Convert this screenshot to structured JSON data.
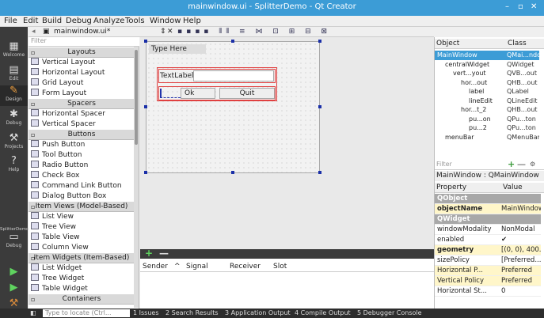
{
  "window": {
    "title": "mainwindow.ui - SplitterDemo - Qt Creator",
    "min": "–",
    "max": "▫",
    "close": "✕"
  },
  "menu": [
    "File",
    "Edit",
    "Build",
    "Debug",
    "Analyze",
    "Tools",
    "Window",
    "Help"
  ],
  "modes": [
    {
      "label": "Welcome",
      "icon": "▦"
    },
    {
      "label": "Edit",
      "icon": "▤"
    },
    {
      "label": "Design",
      "icon": "✎"
    },
    {
      "label": "Debug",
      "icon": "✱"
    },
    {
      "label": "Projects",
      "icon": "⚒"
    },
    {
      "label": "Help",
      "icon": "?"
    }
  ],
  "project": {
    "name": "SplitterDemo",
    "kit": "Debug"
  },
  "file_tab": {
    "name": "mainwindow.ui*",
    "close": "✕"
  },
  "widgetbox": {
    "filter_placeholder": "Filter",
    "rows": [
      {
        "type": "cat",
        "label": "Layouts"
      },
      {
        "type": "item",
        "label": "Vertical Layout"
      },
      {
        "type": "item",
        "label": "Horizontal Layout"
      },
      {
        "type": "item",
        "label": "Grid Layout"
      },
      {
        "type": "item",
        "label": "Form Layout"
      },
      {
        "type": "cat",
        "label": "Spacers"
      },
      {
        "type": "item",
        "label": "Horizontal Spacer"
      },
      {
        "type": "item",
        "label": "Vertical Spacer"
      },
      {
        "type": "cat",
        "label": "Buttons"
      },
      {
        "type": "item",
        "label": "Push Button"
      },
      {
        "type": "item",
        "label": "Tool Button"
      },
      {
        "type": "item",
        "label": "Radio Button"
      },
      {
        "type": "item",
        "label": "Check Box"
      },
      {
        "type": "item",
        "label": "Command Link Button"
      },
      {
        "type": "item",
        "label": "Dialog Button Box"
      },
      {
        "type": "cat",
        "label": "Item Views (Model-Based)"
      },
      {
        "type": "item",
        "label": "List View"
      },
      {
        "type": "item",
        "label": "Tree View"
      },
      {
        "type": "item",
        "label": "Table View"
      },
      {
        "type": "item",
        "label": "Column View"
      },
      {
        "type": "cat",
        "label": "Item Widgets (Item-Based)"
      },
      {
        "type": "item",
        "label": "List Widget"
      },
      {
        "type": "item",
        "label": "Tree Widget"
      },
      {
        "type": "item",
        "label": "Table Widget"
      },
      {
        "type": "cat",
        "label": "Containers"
      }
    ]
  },
  "form": {
    "menu_placeholder": "Type Here",
    "label": "TextLabel",
    "ok": "Ok",
    "quit": "Quit"
  },
  "signals": {
    "columns": [
      "Sender",
      "Signal",
      "Receiver",
      "Slot"
    ],
    "sort_arrow": "^",
    "add": "+",
    "remove": "—"
  },
  "object_inspector": {
    "headers": [
      "Object",
      "Class"
    ],
    "rows": [
      {
        "object": "MainWindow",
        "class": "QMai...ndow",
        "indent": 0,
        "selected": true
      },
      {
        "object": "centralWidget",
        "class": "QWidget",
        "indent": 1
      },
      {
        "object": "vert...yout",
        "class": "QVB...out",
        "indent": 2
      },
      {
        "object": "hor...out",
        "class": "QHB...out",
        "indent": 3
      },
      {
        "object": "label",
        "class": "QLabel",
        "indent": 4
      },
      {
        "object": "lineEdit",
        "class": "QLineEdit",
        "indent": 4
      },
      {
        "object": "hor...t_2",
        "class": "QHB...out",
        "indent": 3
      },
      {
        "object": "pu...on",
        "class": "QPu...ton",
        "indent": 4
      },
      {
        "object": "pu...2",
        "class": "QPu...ton",
        "indent": 4
      },
      {
        "object": "menuBar",
        "class": "QMenuBar",
        "indent": 1
      }
    ]
  },
  "property_editor": {
    "filter_placeholder": "Filter",
    "add": "+",
    "remove": "—",
    "wrench": "⚙",
    "class_line": "MainWindow : QMainWindow",
    "headers": [
      "Property",
      "Value"
    ],
    "rows": [
      {
        "name": "QObject",
        "value": "",
        "kind": "grp"
      },
      {
        "name": "objectName",
        "value": "MainWindow",
        "kind": "yb"
      },
      {
        "name": "QWidget",
        "value": "",
        "kind": "grp"
      },
      {
        "name": "windowModality",
        "value": "NonModal",
        "kind": ""
      },
      {
        "name": "enabled",
        "value": "✔",
        "kind": ""
      },
      {
        "name": "geometry",
        "value": "[(0, 0), 400...",
        "kind": "yb"
      },
      {
        "name": "sizePolicy",
        "value": "[Preferred...",
        "kind": ""
      },
      {
        "name": "Horizontal P...",
        "value": "Preferred",
        "kind": "y"
      },
      {
        "name": "Vertical Policy",
        "value": "Preferred",
        "kind": "y"
      },
      {
        "name": "Horizontal St...",
        "value": "0",
        "kind": ""
      }
    ]
  },
  "statusbar": {
    "locate_placeholder": "Type to locate (Ctrl...",
    "tabs": [
      "1 Issues",
      "2 Search Results",
      "3 Application Output",
      "4 Compile Output",
      "5 Debugger Console"
    ]
  }
}
